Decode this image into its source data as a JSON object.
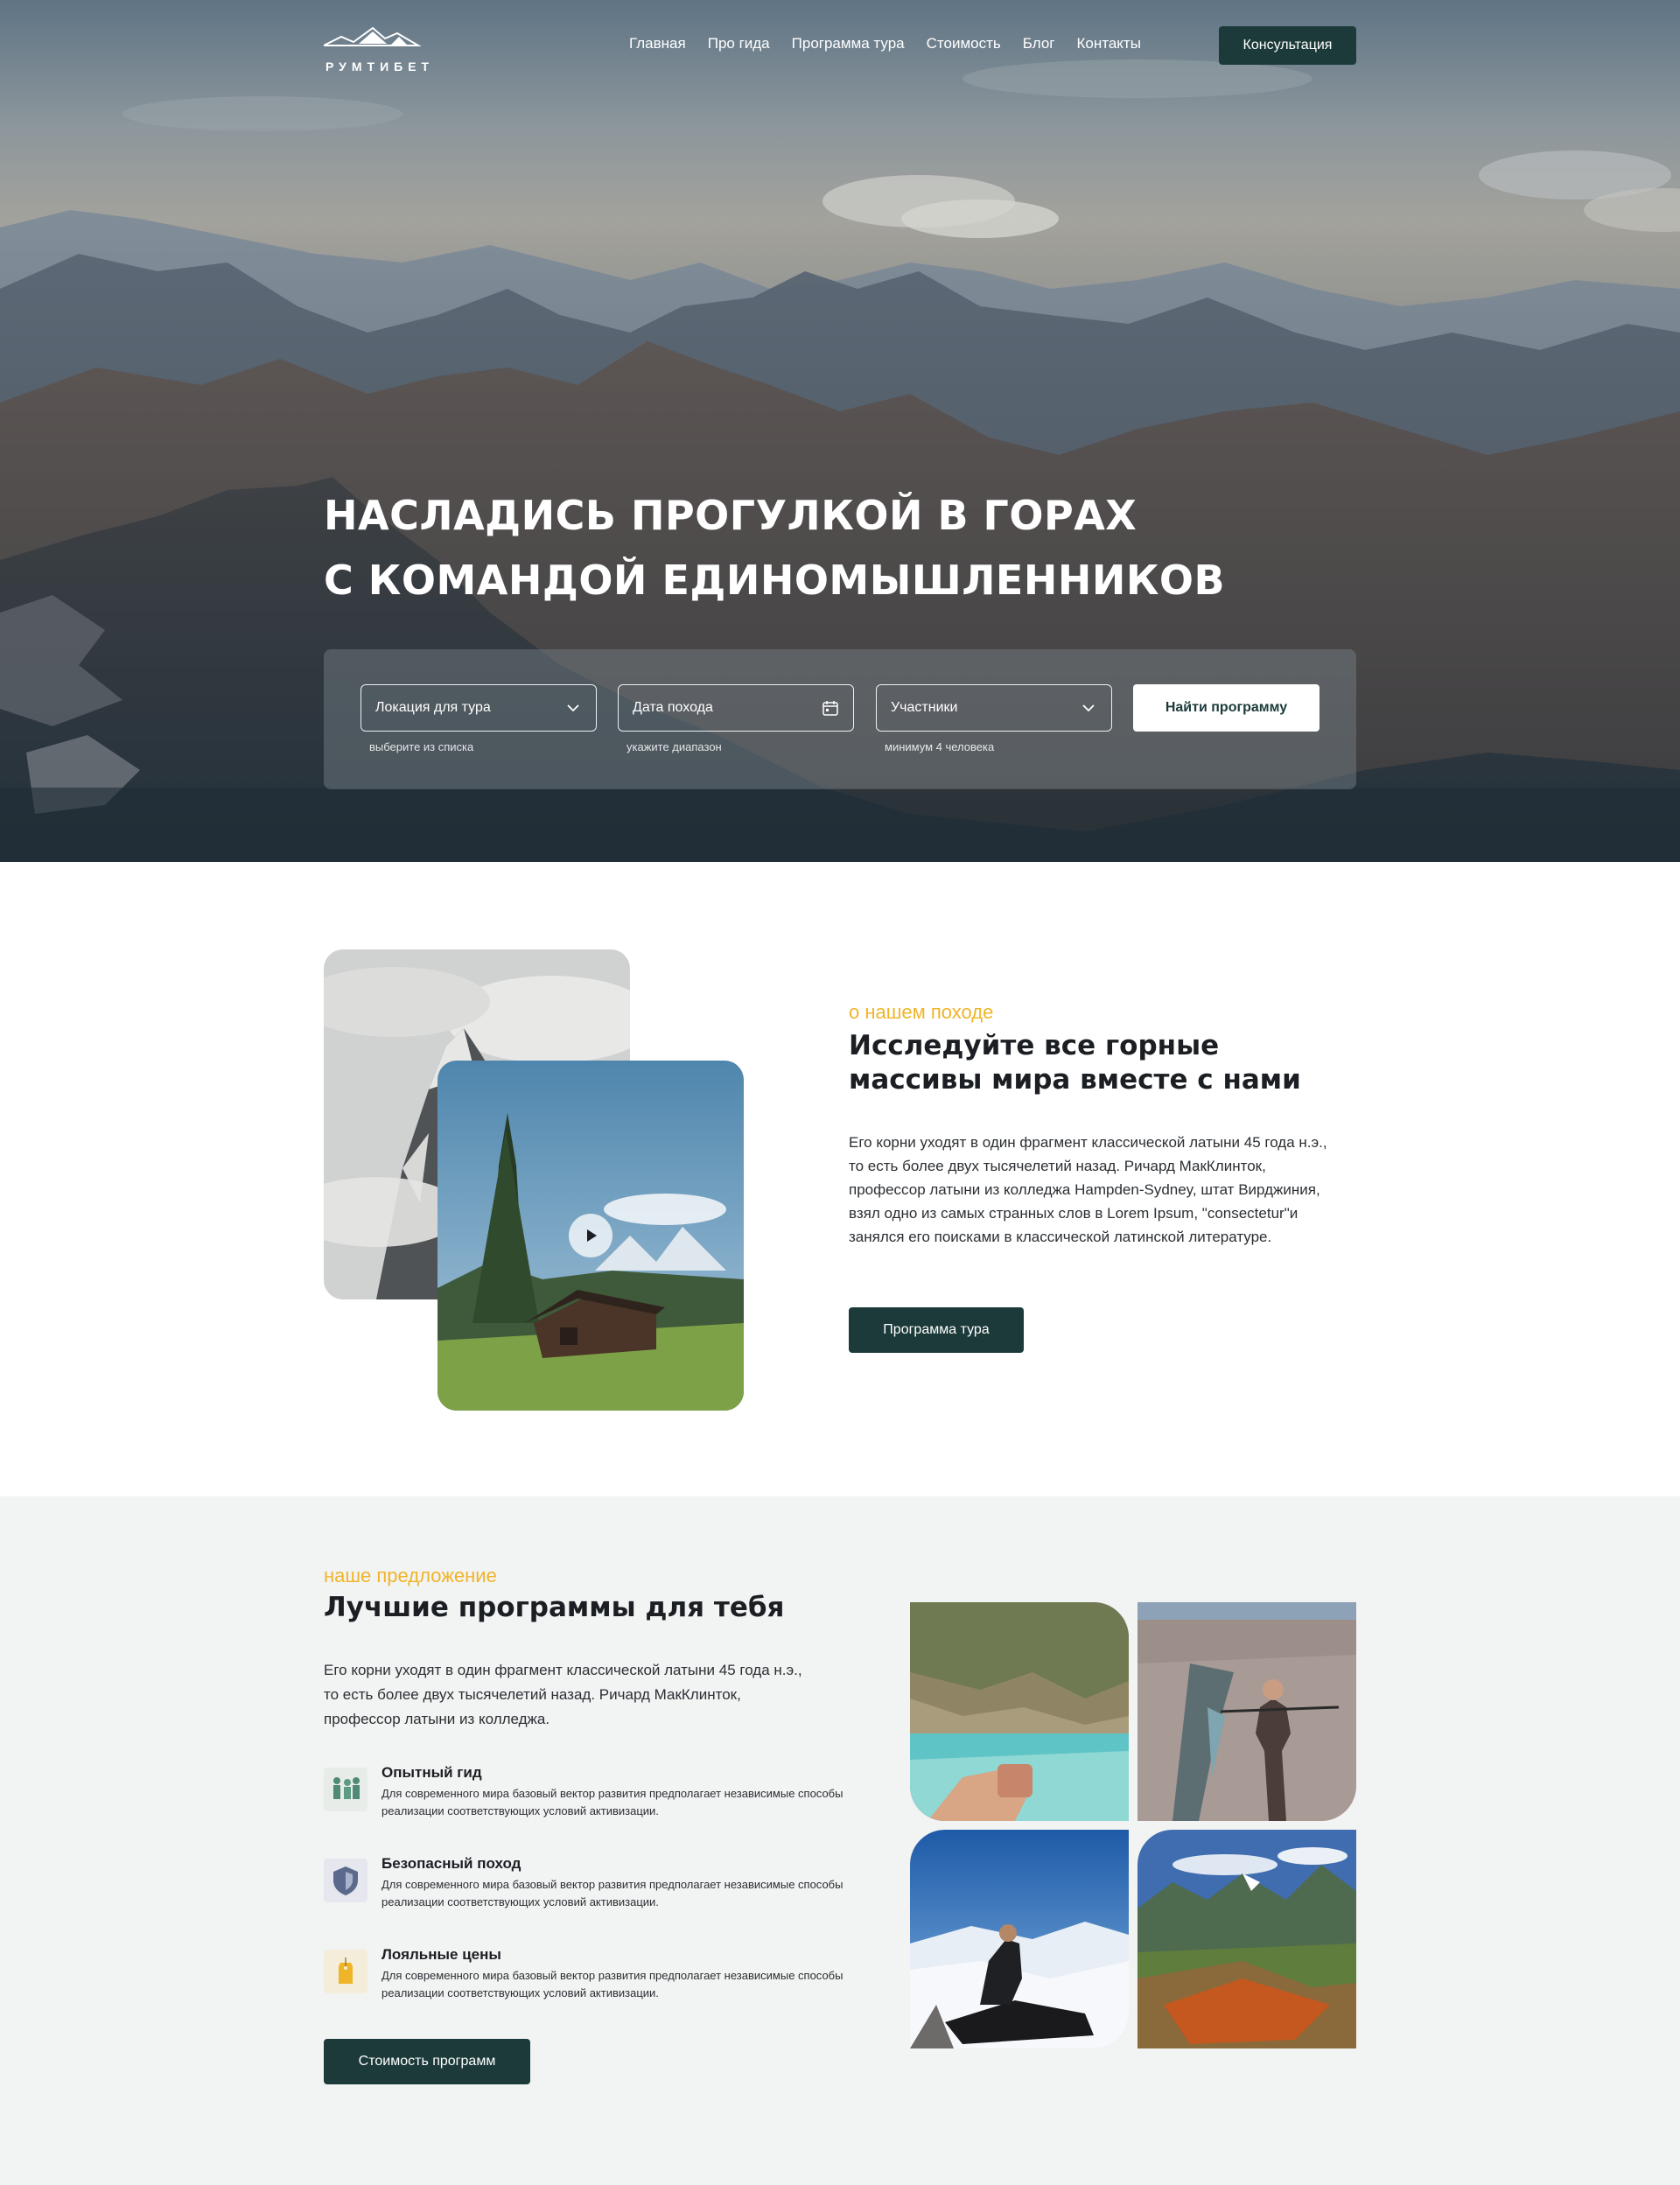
{
  "brand": {
    "logo_text": "РУМТИБЕТ"
  },
  "nav": {
    "items": [
      "Главная",
      "Про гида",
      "Программа тура",
      "Стоимость",
      "Блог",
      "Контакты"
    ],
    "cta": "Консультация"
  },
  "hero": {
    "title_line1": "НАСЛАДИСЬ ПРОГУЛКОЙ В ГОРАХ",
    "title_line2": "С КОМАНДОЙ ЕДИНОМЫШЛЕННИКОВ",
    "search": {
      "location": {
        "placeholder": "Локация для тура",
        "hint": "выберите из списка"
      },
      "date": {
        "placeholder": "Дата похода",
        "hint": "укажите диапазон"
      },
      "participants": {
        "placeholder": "Участники",
        "hint": "минимум 4 человека"
      },
      "submit": "Найти программу"
    }
  },
  "about": {
    "tag": "о нашем походе",
    "title": "Исследуйте все горные массивы мира вместе с нами",
    "text": "Его корни уходят в один фрагмент классической латыни 45 года н.э., то есть более двух тысячелетий назад. Ричард МакКлинток, профессор латыни из колледжа Hampden-Sydney, штат Вирджиния, взял одно из самых странных слов в Lorem Ipsum, \"consectetur\"и занялся его поисками в классической латинской литературе.",
    "button": "Программа тура"
  },
  "programs": {
    "tag": "наше предложение",
    "title": "Лучшие программы для тебя",
    "text": "Его корни уходят в один фрагмент классической латыни 45 года н.э., то есть более двух тысячелетий назад. Ричард МакКлинток, профессор латыни из колледжа.",
    "features": [
      {
        "title": "Опытный гид",
        "text": "Для современного мира базовый вектор развития предполагает независимые способы реализации соответствующих условий активизации.",
        "icon": "people-icon"
      },
      {
        "title": "Безопасный поход",
        "text": "Для современного мира базовый вектор развития предполагает независимые способы реализации соответствующих условий активизации.",
        "icon": "shield-icon"
      },
      {
        "title": "Лояльные цены",
        "text": "Для современного мира базовый вектор развития предполагает независимые способы реализации соответствующих условий активизации.",
        "icon": "price-tag-icon"
      }
    ],
    "button": "Стоимость программ"
  },
  "colors": {
    "accent": "#f0b429",
    "dark_green": "#1c3a3a",
    "section_bg": "#f2f3f3"
  }
}
